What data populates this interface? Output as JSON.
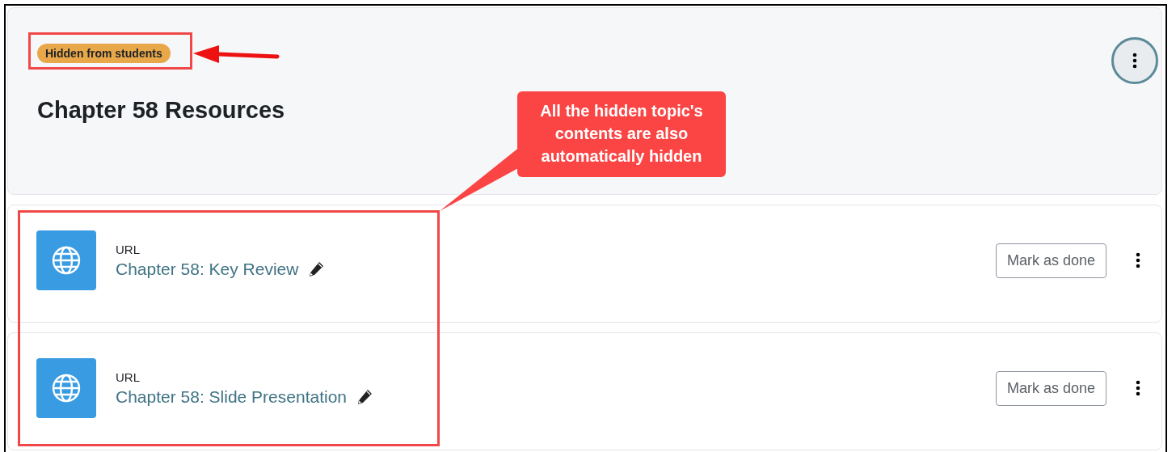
{
  "section": {
    "badge": "Hidden from students",
    "title": "Chapter 58 Resources"
  },
  "activities": [
    {
      "type": "URL",
      "name": "Chapter 58: Key Review",
      "action": "Mark as done"
    },
    {
      "type": "URL",
      "name": "Chapter 58: Slide Presentation",
      "action": "Mark as done"
    }
  ],
  "callout": "All the hidden topic's contents are also automatically hidden"
}
